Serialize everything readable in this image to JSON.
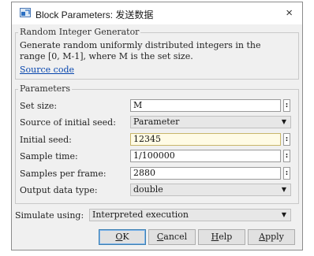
{
  "window": {
    "title": "Block Parameters: 发送数据",
    "close_symbol": "×"
  },
  "block_group": {
    "legend": "Random Integer Generator",
    "description": "Generate random uniformly distributed integers in the\nrange [0, M-1], where M is the set size.",
    "source_link": "Source code"
  },
  "params_group": {
    "legend": "Parameters",
    "rows": {
      "set_size": {
        "label": "Set size:",
        "value": "M"
      },
      "seed_source": {
        "label": "Source of initial seed:",
        "value": "Parameter"
      },
      "initial_seed": {
        "label": "Initial seed:",
        "value": "12345"
      },
      "sample_time": {
        "label": "Sample time:",
        "value": "1/100000"
      },
      "samples_per_frame": {
        "label": "Samples per frame:",
        "value": "2880"
      },
      "output_type": {
        "label": "Output data type:",
        "value": "double"
      }
    },
    "param_menu_symbol": ":"
  },
  "simulate": {
    "label": "Simulate using:",
    "value": "Interpreted execution"
  },
  "buttons": {
    "ok": {
      "mnemonic": "O",
      "rest": "K"
    },
    "cancel": {
      "mnemonic": "C",
      "rest": "ancel"
    },
    "help": {
      "mnemonic": "H",
      "rest": "elp"
    },
    "apply": {
      "mnemonic": "A",
      "rest": "pply"
    }
  },
  "icons": {
    "app": "simulink-block-icon",
    "dropdown": "chevron-down-icon"
  },
  "colors": {
    "dialog_bg": "#f0f0f0",
    "link": "#0645ad",
    "active_field_bg": "#fffbe5"
  }
}
